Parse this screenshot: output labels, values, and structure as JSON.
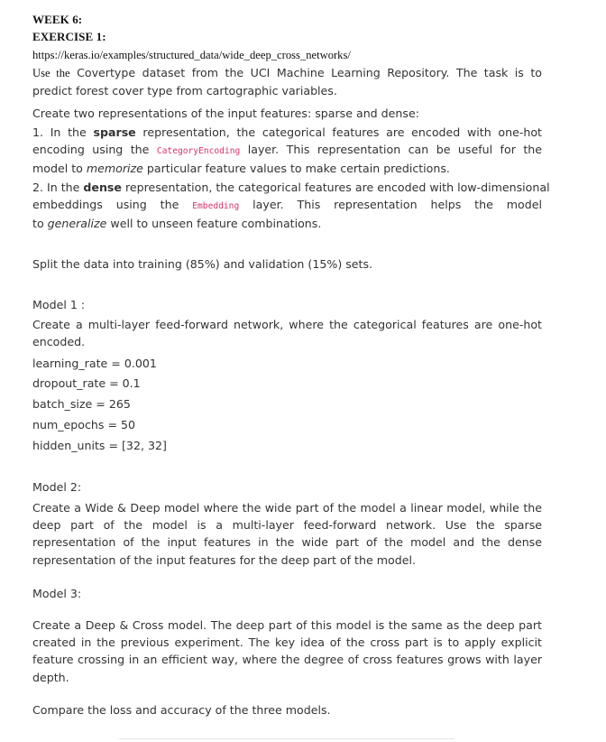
{
  "header": {
    "week": "WEEK 6:",
    "exercise": "EXERCISE 1:",
    "url": "https://keras.io/examples/structured_data/wide_deep_cross_networks/"
  },
  "intro": {
    "use_prefix": "Use the",
    "use_rest_1": "Covertype dataset from the UCI Machine Learning Repository. The task is to",
    "use_rest_2": "predict forest cover type from cartographic variables.",
    "create_repr": "Create two representations of the input features: sparse and dense:"
  },
  "sparse": {
    "l1_a": "1. In the ",
    "l1_bold": "sparse",
    "l1_b": " representation, the categorical features are encoded with one-hot",
    "l2_a": "encoding using the ",
    "l2_code": "CategoryEncoding",
    "l2_b": " layer. This representation can be useful for the",
    "l3_a": "model to ",
    "l3_em": "memorize",
    "l3_b": " particular feature values to make certain predictions."
  },
  "dense": {
    "l1_a": "2. In the ",
    "l1_bold": "dense",
    "l1_b": " representation, the categorical features are encoded with low-dimensional",
    "l2_a": "embeddings using the ",
    "l2_code": "Embedding",
    "l2_b": " layer. This representation helps the model",
    "l3_a": "to ",
    "l3_em": "generalize",
    "l3_b": " well to unseen feature combinations."
  },
  "split": "Split the data into training (85%) and validation (15%) sets.",
  "model1": {
    "title": "Model 1 :",
    "desc_1": "Create a multi-layer feed-forward network, where the categorical features are one-hot",
    "desc_2": "encoded.",
    "params": [
      "learning_rate = 0.001",
      "dropout_rate = 0.1",
      "batch_size = 265",
      "num_epochs = 50",
      "hidden_units = [32, 32]"
    ]
  },
  "model2": {
    "title": "Model 2:",
    "desc": [
      "Create a Wide & Deep model where the wide part of the model a linear model, while the",
      "deep part of the model is a multi-layer feed-forward network. Use the sparse",
      "representation of the input features in the wide part of the model and the dense",
      "representation of the input features for the deep part of the model."
    ]
  },
  "model3": {
    "title": "Model 3:",
    "desc": [
      "Create a Deep & Cross model. The deep part of this model is the same as the deep part",
      "created in the previous experiment. The key idea of the cross part is to apply explicit",
      "feature crossing in an efficient way, where the degree of cross features grows with layer",
      "depth."
    ]
  },
  "compare": "Compare the loss and accuracy of the three models."
}
